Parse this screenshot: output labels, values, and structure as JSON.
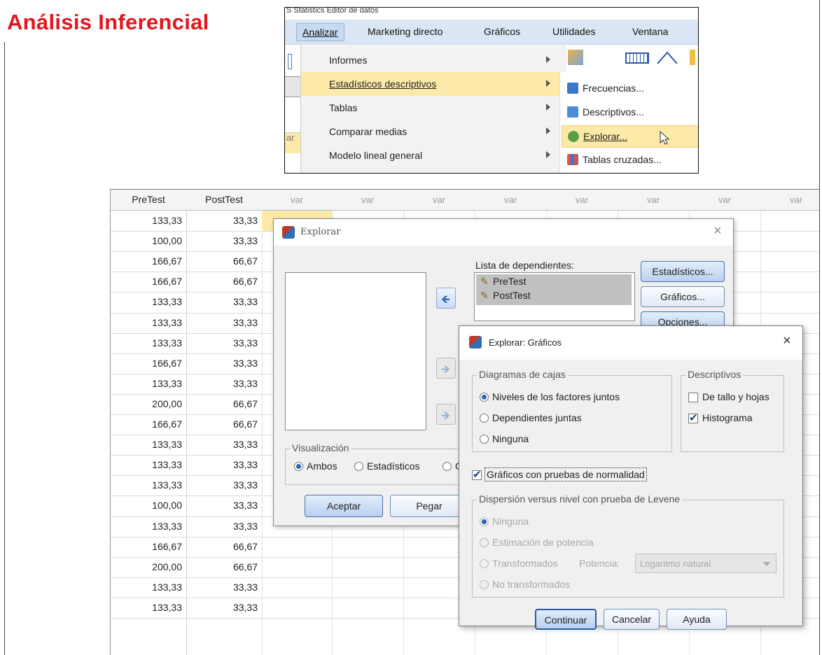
{
  "slide": {
    "title": "Análisis Inferencial"
  },
  "menu": {
    "window_title": "S Statistics Editor de datos",
    "menubar": [
      "Analizar",
      "Marketing directo",
      "Gráficos",
      "Utilidades",
      "Ventana"
    ],
    "analizar_items": [
      "Informes",
      "Estadísticos descriptivos",
      "Tablas",
      "Comparar medias",
      "Modelo lineal general"
    ],
    "submenu_items": [
      "Frecuencias...",
      "Descriptivos...",
      "Explorar...",
      "Tablas cruzadas..."
    ],
    "left_fragment": "ar"
  },
  "sheet": {
    "columns": [
      "PreTest",
      "PostTest",
      "var",
      "var",
      "var",
      "var",
      "var",
      "var",
      "var",
      "var"
    ],
    "rows": [
      [
        "133,33",
        "33,33"
      ],
      [
        "100,00",
        "33,33"
      ],
      [
        "166,67",
        "66,67"
      ],
      [
        "166,67",
        "66,67"
      ],
      [
        "133,33",
        "33,33"
      ],
      [
        "133,33",
        "33,33"
      ],
      [
        "133,33",
        "33,33"
      ],
      [
        "166,67",
        "33,33"
      ],
      [
        "133,33",
        "33,33"
      ],
      [
        "200,00",
        "66,67"
      ],
      [
        "166,67",
        "66,67"
      ],
      [
        "133,33",
        "33,33"
      ],
      [
        "133,33",
        "33,33"
      ],
      [
        "133,33",
        "33,33"
      ],
      [
        "100,00",
        "33,33"
      ],
      [
        "133,33",
        "33,33"
      ],
      [
        "166,67",
        "66,67"
      ],
      [
        "200,00",
        "66,67"
      ],
      [
        "133,33",
        "33,33"
      ],
      [
        "133,33",
        "33,33"
      ]
    ]
  },
  "explorar": {
    "title": "Explorar",
    "close": "×",
    "dependientes_label": "Lista de dependientes:",
    "dependientes": [
      "PreTest",
      "PostTest"
    ],
    "buttons": {
      "estadisticos": "Estadísticos...",
      "graficos": "Gráficos...",
      "opciones": "Opciones..."
    },
    "visualizacion_label": "Visualización",
    "visualizacion_options": [
      "Ambos",
      "Estadísticos",
      "G"
    ],
    "aceptar": "Aceptar",
    "pegar": "Pegar"
  },
  "graficos": {
    "title": "Explorar: Gráficos",
    "close": "×",
    "cajas_label": "Diagramas de cajas",
    "cajas_options": [
      "Niveles de los factores juntos",
      "Dependientes juntas",
      "Ninguna"
    ],
    "descriptivos_label": "Descriptivos",
    "descriptivos_options": [
      "De tallo y hojas",
      "Histograma"
    ],
    "normalidad": "Gráficos con pruebas de normalidad",
    "levene_label": "Dispersión versus nivel con prueba de Levene",
    "levene_options": [
      "Ninguna",
      "Estimación de potencia",
      "Transformados",
      "No transformados"
    ],
    "potencia_label": "Potencia:",
    "potencia_value": "Logaritmo natural",
    "continuar": "Continuar",
    "cancelar": "Cancelar",
    "ayuda": "Ayuda"
  }
}
